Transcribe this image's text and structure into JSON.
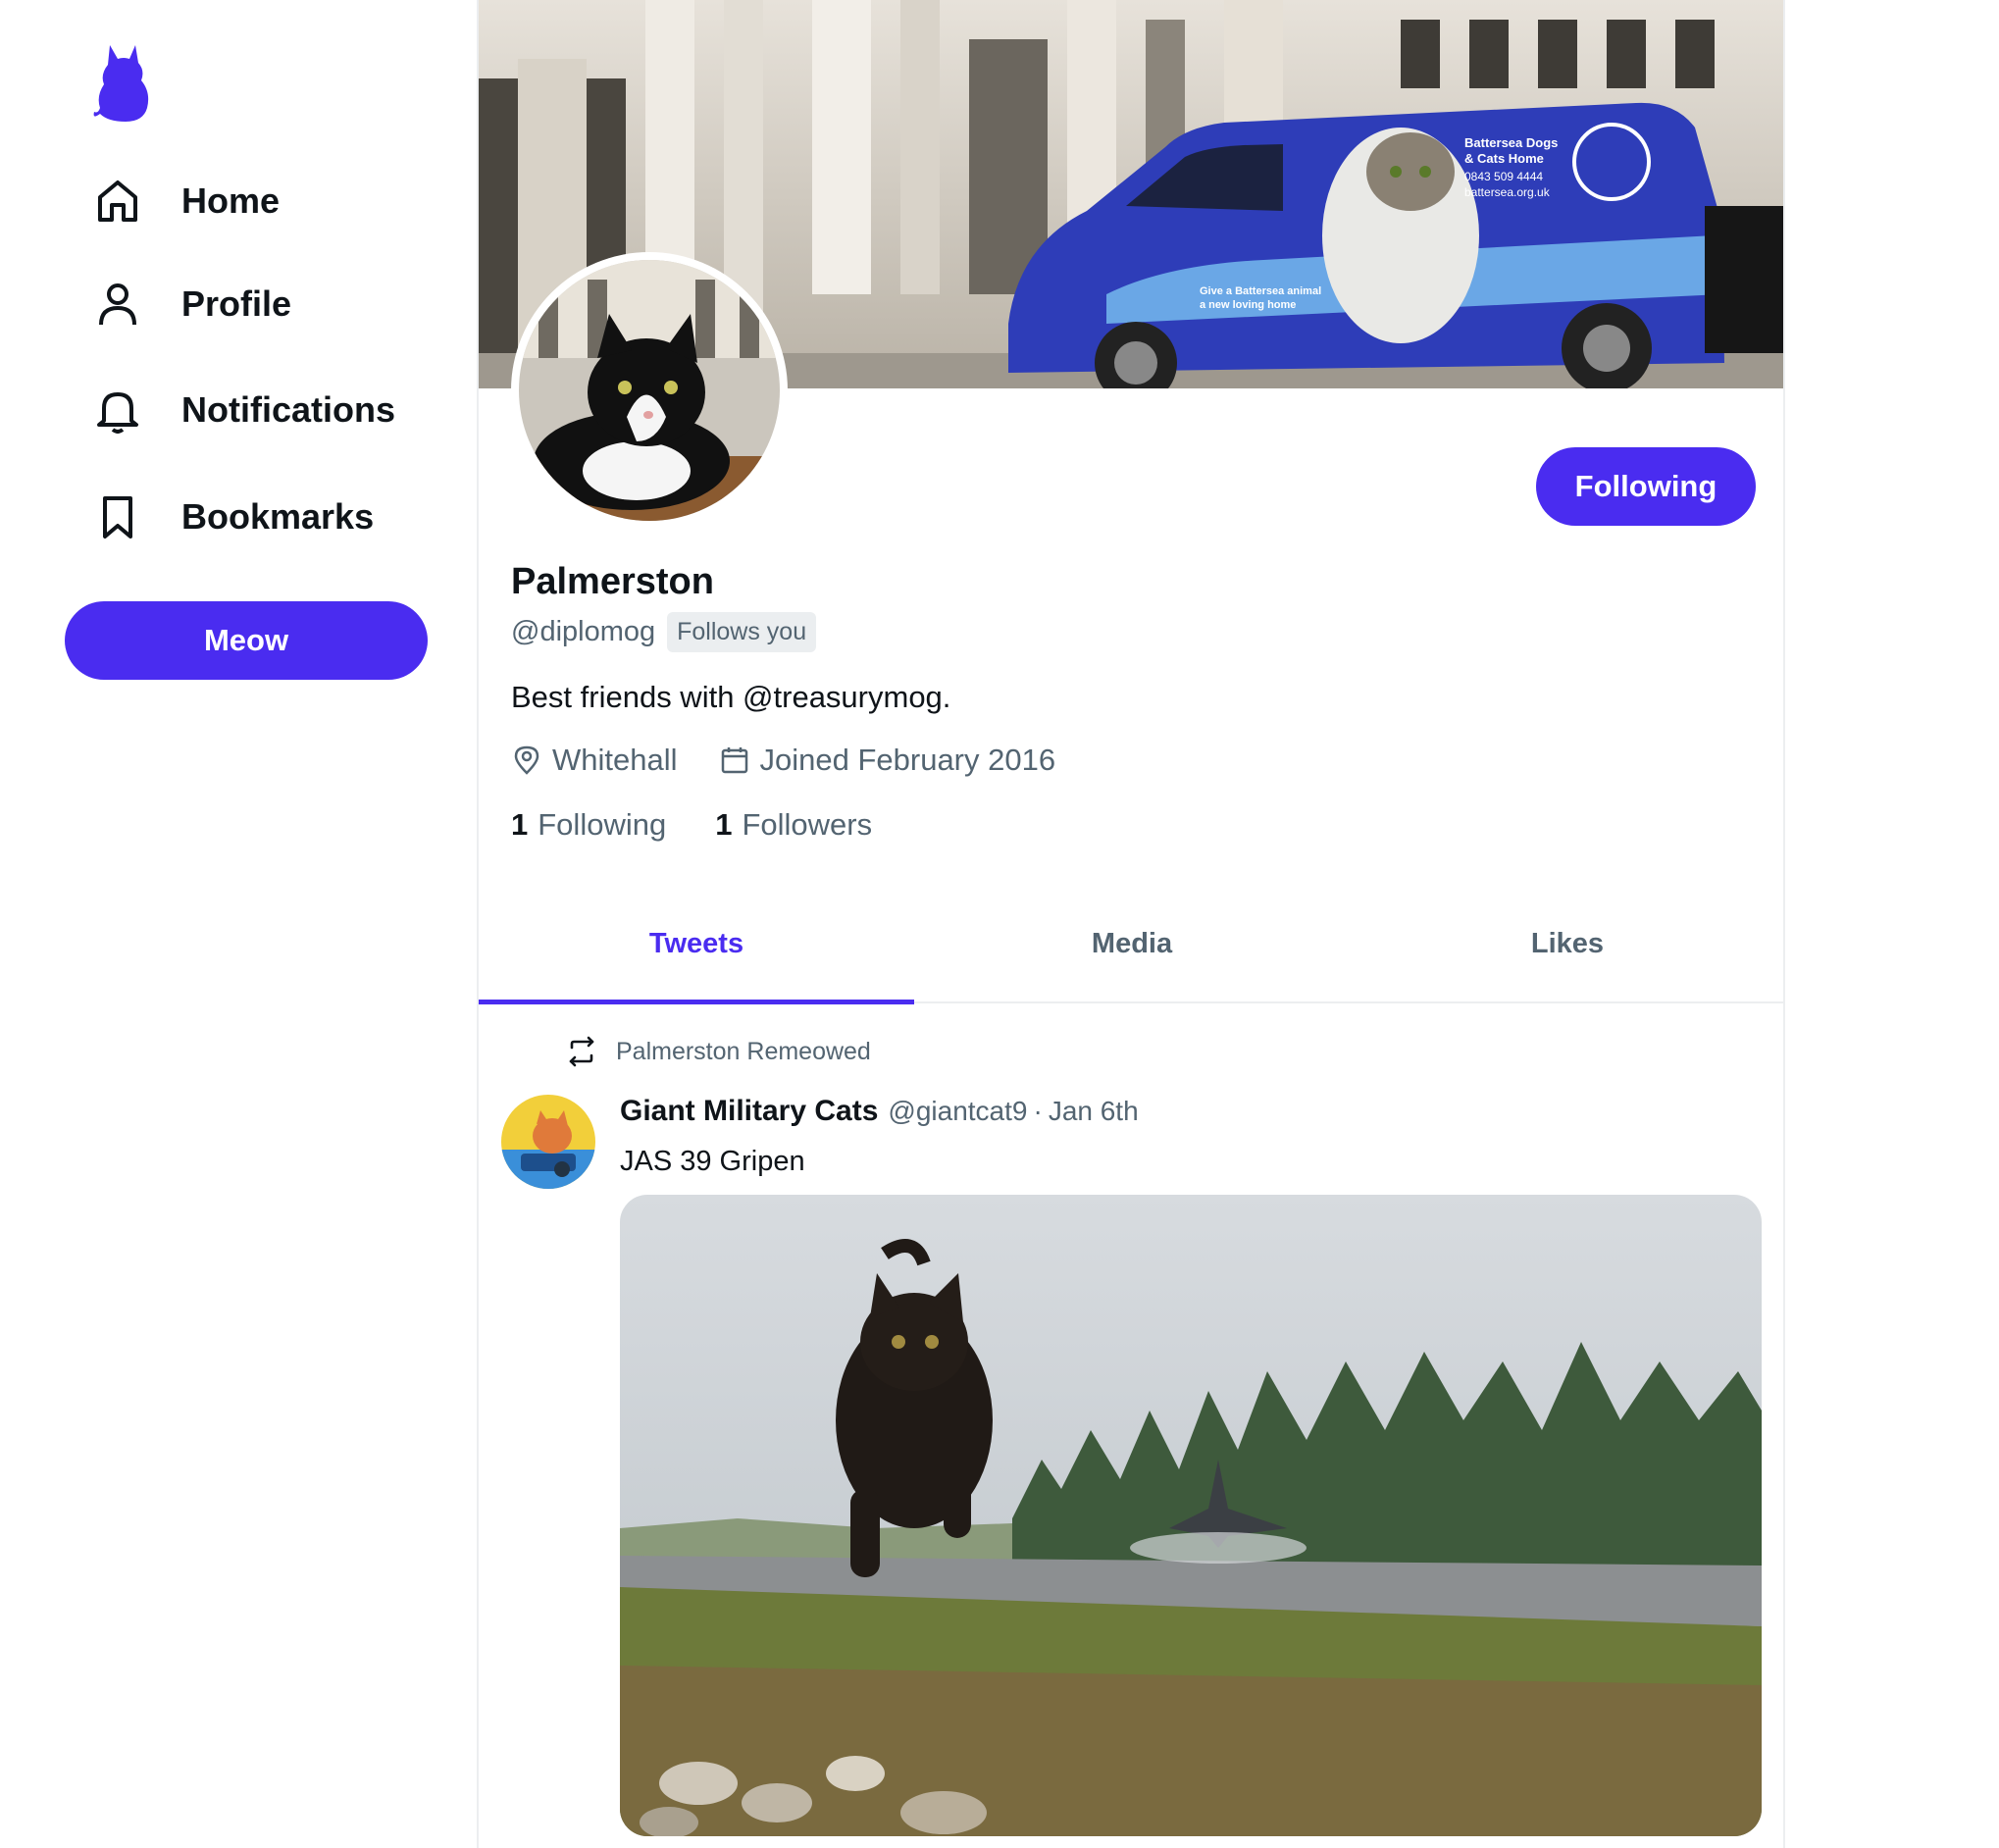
{
  "sidebar": {
    "logo_icon": "cat-logo-icon",
    "items": [
      {
        "label": "Home",
        "icon": "home-icon"
      },
      {
        "label": "Profile",
        "icon": "person-icon"
      },
      {
        "label": "Notifications",
        "icon": "bell-icon"
      },
      {
        "label": "Bookmarks",
        "icon": "bookmark-icon"
      }
    ],
    "meow_label": "Meow"
  },
  "profile": {
    "display_name": "Palmerston",
    "handle": "@diplomog",
    "follows_you": "Follows you",
    "bio": "Best friends with @treasurymog.",
    "location": "Whitehall",
    "joined": "Joined February 2016",
    "following_count": "1",
    "following_label": "Following",
    "followers_count": "1",
    "followers_label": "Followers",
    "follow_button_label": "Following",
    "banner_van_text": {
      "line1": "Battersea Dogs",
      "line2": "& Cats Home",
      "line3": "0843 509 4444",
      "line4": "battersea.org.uk",
      "side1": "Give a Battersea animal",
      "side2": "a new loving home"
    }
  },
  "tabs": [
    {
      "label": "Tweets",
      "active": true
    },
    {
      "label": "Media",
      "active": false
    },
    {
      "label": "Likes",
      "active": false
    }
  ],
  "tweet": {
    "remeow_text": "Palmerston Remeowed",
    "author": "Giant Military Cats",
    "handle": "@giantcat9",
    "separator": "·",
    "date": "Jan 6th",
    "text": "JAS 39 Gripen"
  },
  "colors": {
    "accent": "#4a2cf0",
    "muted_text": "#536471",
    "border": "#eceef0"
  }
}
